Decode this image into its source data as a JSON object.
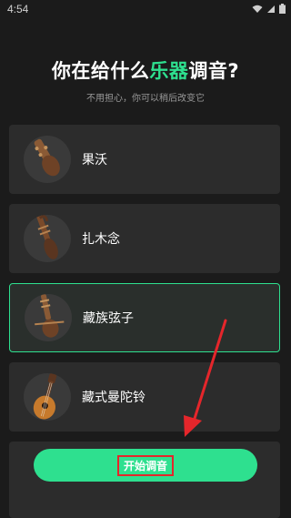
{
  "status_bar": {
    "time": "4:54",
    "icons": [
      "wifi-icon",
      "cell-signal-icon",
      "battery-icon"
    ]
  },
  "header": {
    "title_part1": "你在给什么",
    "title_accent": "乐器",
    "title_part2": "调音?",
    "subtitle": "不用担心，你可以稍后改变它"
  },
  "instruments": [
    {
      "label": "果沃",
      "selected": false,
      "icon": "guowo-instrument-icon"
    },
    {
      "label": "扎木念",
      "selected": false,
      "icon": "dramyin-instrument-icon"
    },
    {
      "label": "藏族弦子",
      "selected": true,
      "icon": "tibetan-fiddle-instrument-icon"
    },
    {
      "label": "藏式曼陀铃",
      "selected": false,
      "icon": "mandolin-instrument-icon"
    }
  ],
  "start_button": {
    "label": "开始调音"
  },
  "colors": {
    "accent": "#2ee08f",
    "background": "#1b1b1b",
    "card": "#2c2c2c",
    "annotation": "#e5262b"
  }
}
